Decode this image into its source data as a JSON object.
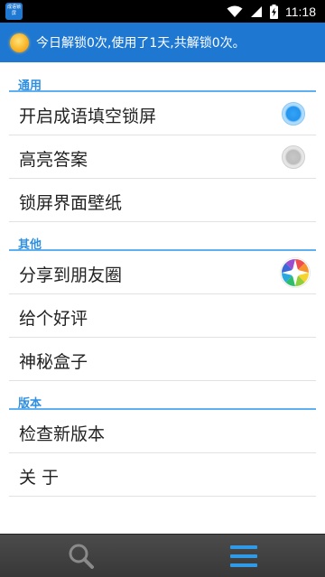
{
  "status_bar": {
    "app_icon_text": "成语锁屏",
    "time": "11:18",
    "icons": [
      "wifi-icon",
      "signal-icon",
      "battery-charging-icon"
    ]
  },
  "header": {
    "icon": "sun-icon",
    "message": "今日解锁0次,使用了1天,共解锁0次。"
  },
  "sections": [
    {
      "title": "通用",
      "items": [
        {
          "label": "开启成语填空锁屏",
          "control": "radio",
          "checked": true
        },
        {
          "label": "高亮答案",
          "control": "radio",
          "checked": false
        },
        {
          "label": "锁屏界面壁纸"
        }
      ]
    },
    {
      "title": "其他",
      "items": [
        {
          "label": "分享到朋友圈",
          "icon": "moments-aperture-icon"
        },
        {
          "label": "给个好评"
        },
        {
          "label": "神秘盒子"
        }
      ]
    },
    {
      "title": "版本",
      "items": [
        {
          "label": "检查新版本"
        },
        {
          "label": "关 于"
        }
      ]
    }
  ],
  "bottom_nav": {
    "items": [
      {
        "icon": "search-icon",
        "active": false
      },
      {
        "icon": "menu-icon",
        "active": true
      }
    ]
  },
  "colors": {
    "header_bg": "#1e78d2",
    "accent": "#2f8fe0",
    "radio_on": "#2394ee",
    "radio_off": "#bdbdbd",
    "bottom_bar": "#404040"
  }
}
